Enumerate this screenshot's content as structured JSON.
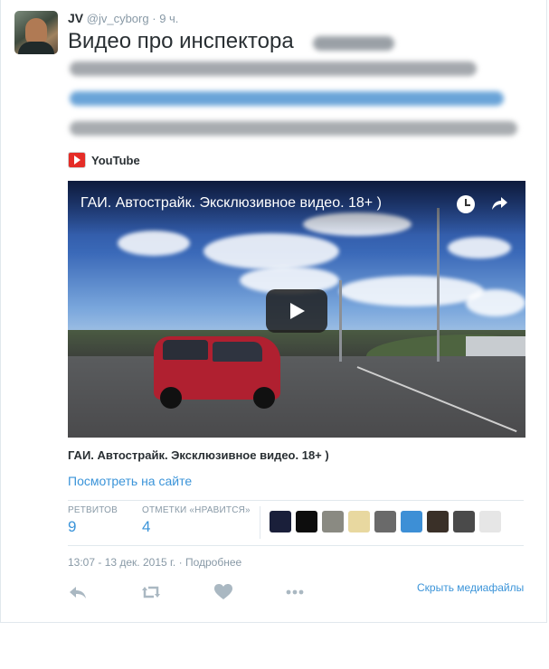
{
  "tweet": {
    "author_name": "JV",
    "author_handle": "@jv_cyborg",
    "separator": "·",
    "time_ago": "9 ч.",
    "text": "Видео про инспектора"
  },
  "card": {
    "provider": "YouTube",
    "video_title": "ГАИ. Автострайк. Эксклюзивное видео. 18+ )",
    "caption": "ГАИ. Автострайк. Эксклюзивное видео. 18+ )",
    "view_link": "Посмотреть на сайте"
  },
  "stats": {
    "retweets_label": "РЕТВИТОВ",
    "retweets_value": "9",
    "likes_label": "ОТМЕТКИ «НРАВИТСЯ»",
    "likes_value": "4"
  },
  "likers": [
    {
      "name": "liker-1",
      "color": "#1a1f3a"
    },
    {
      "name": "liker-2",
      "color": "#0d0d0d"
    },
    {
      "name": "liker-3",
      "color": "#8a8a82"
    },
    {
      "name": "liker-4",
      "color": "#e8d8a0"
    },
    {
      "name": "liker-5",
      "color": "#6a6a6a"
    },
    {
      "name": "liker-6",
      "color": "#3d8fd6"
    },
    {
      "name": "liker-7",
      "color": "#3a3028"
    },
    {
      "name": "liker-8",
      "color": "#4a4a4a"
    },
    {
      "name": "liker-9",
      "color": "#e6e6e6"
    }
  ],
  "timestamp": {
    "datetime": "13:07 - 13 дек. 2015 г.",
    "separator": "·",
    "details": "Подробнее"
  },
  "actions": {
    "hide_media": "Скрыть медиафайлы",
    "icons": [
      "reply-icon",
      "retweet-icon",
      "like-icon",
      "more-icon"
    ]
  },
  "colors": {
    "link": "#3b94d9",
    "muted": "#8899a6",
    "text": "#292f33",
    "youtube_red": "#e52d27"
  }
}
